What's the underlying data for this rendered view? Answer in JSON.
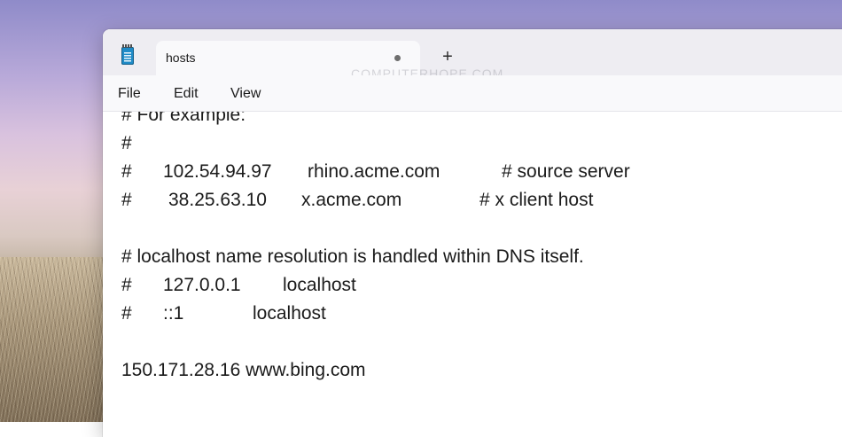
{
  "window": {
    "tab_title": "hosts",
    "new_tab_symbol": "+",
    "watermark": "COMPUTERHOPE.COM"
  },
  "menu": {
    "file": "File",
    "edit": "Edit",
    "view": "View"
  },
  "editor": {
    "line_example": "# For example:",
    "line_hash": "#",
    "row1": {
      "hash": "#",
      "ip": "102.54.94.97",
      "host": "rhino.acme.com",
      "comment": "# source server"
    },
    "row2": {
      "hash": "#",
      "ip": "38.25.63.10",
      "host": "x.acme.com",
      "comment": "# x client host"
    },
    "line_localhost_comment": "# localhost name resolution is handled within DNS itself.",
    "row3": {
      "hash": "#",
      "ip": "127.0.0.1",
      "host": "localhost"
    },
    "row4": {
      "hash": "#",
      "ip": "::1",
      "host": "localhost"
    },
    "line_bing": "150.171.28.16 www.bing.com"
  },
  "colors": {
    "accent": "#1f8bc7"
  }
}
